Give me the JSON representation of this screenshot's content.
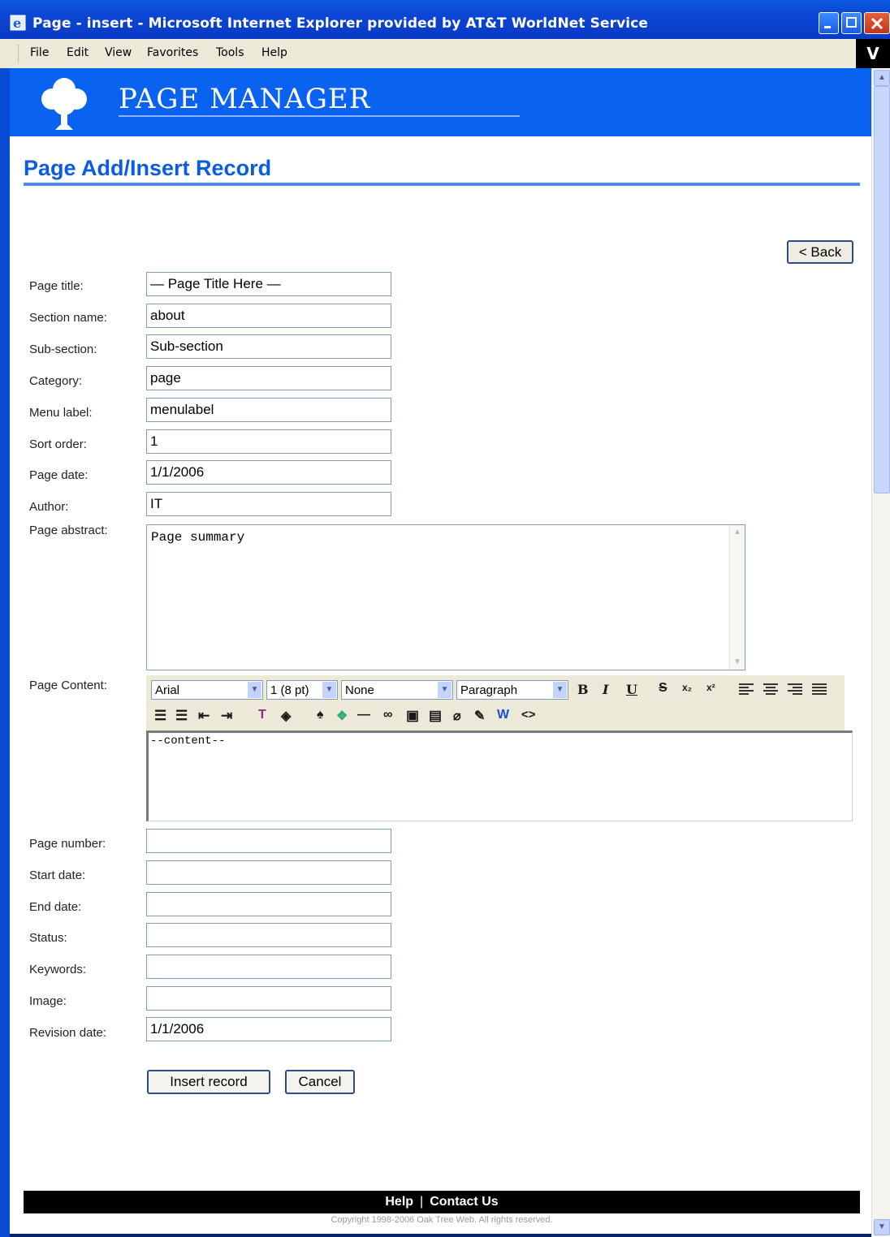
{
  "window": {
    "title": "Page - insert - Microsoft Internet Explorer provided by AT&T WorldNet Service"
  },
  "menubar": {
    "items": [
      "File",
      "Edit",
      "View",
      "Favorites",
      "Tools",
      "Help"
    ],
    "logo": "V"
  },
  "banner": {
    "brand": "PAGE MANAGER"
  },
  "page": {
    "heading": "Page Add/Insert Record",
    "back_label": "< Back"
  },
  "form": {
    "fields": [
      {
        "label": "Page title:",
        "value": "— Page Title Here —"
      },
      {
        "label": "Section name:",
        "value": "about"
      },
      {
        "label": "Sub-section:",
        "value": "Sub-section"
      },
      {
        "label": "Category:",
        "value": "page"
      },
      {
        "label": "Menu label:",
        "value": "menulabel"
      },
      {
        "label": "Sort order:",
        "value": "1"
      },
      {
        "label": "Page date:",
        "value": "1/1/2006"
      },
      {
        "label": "Author:",
        "value": "IT"
      }
    ],
    "abstract": {
      "label": "Page abstract:",
      "value": "Page summary"
    },
    "content": {
      "label": "Page Content:",
      "font": "Arial",
      "size": "1 (8 pt)",
      "style": "None",
      "format": "Paragraph",
      "value": "--content--"
    },
    "fields2": [
      {
        "label": "Page number:",
        "value": ""
      },
      {
        "label": "Start date:",
        "value": ""
      },
      {
        "label": "End date:",
        "value": ""
      },
      {
        "label": "Status:",
        "value": ""
      },
      {
        "label": "Keywords:",
        "value": ""
      },
      {
        "label": "Image:",
        "value": ""
      },
      {
        "label": "Revision date:",
        "value": "1/1/2006"
      }
    ],
    "insert_label": "Insert record",
    "cancel_label": "Cancel"
  },
  "footer": {
    "help": "Help",
    "separator": "|",
    "contact": "Contact Us",
    "copyright": "Copyright 1998-2006 Oak Tree Web. All rights reserved."
  }
}
